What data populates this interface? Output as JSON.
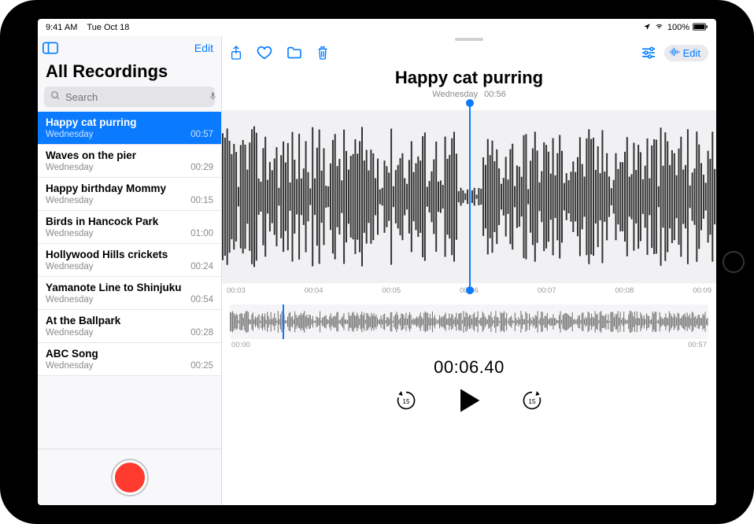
{
  "status_bar": {
    "time": "9:41 AM",
    "date": "Tue Oct 18",
    "location_icon": "location",
    "wifi_icon": "wifi",
    "battery_pct": "100%"
  },
  "sidebar": {
    "edit_label": "Edit",
    "title": "All Recordings",
    "search_placeholder": "Search",
    "items": [
      {
        "title": "Happy cat purring",
        "day": "Wednesday",
        "duration": "00:57",
        "selected": true
      },
      {
        "title": "Waves on the pier",
        "day": "Wednesday",
        "duration": "00:29",
        "selected": false
      },
      {
        "title": "Happy birthday Mommy",
        "day": "Wednesday",
        "duration": "00:15",
        "selected": false
      },
      {
        "title": "Birds in Hancock Park",
        "day": "Wednesday",
        "duration": "01:00",
        "selected": false
      },
      {
        "title": "Hollywood Hills crickets",
        "day": "Wednesday",
        "duration": "00:24",
        "selected": false
      },
      {
        "title": "Yamanote Line to Shinjuku",
        "day": "Wednesday",
        "duration": "00:54",
        "selected": false
      },
      {
        "title": "At the Ballpark",
        "day": "Wednesday",
        "duration": "00:28",
        "selected": false
      },
      {
        "title": "ABC Song",
        "day": "Wednesday",
        "duration": "00:25",
        "selected": false
      }
    ]
  },
  "detail": {
    "toolbar": {
      "share_icon": "share",
      "favorite_icon": "heart",
      "folder_icon": "folder",
      "trash_icon": "trash",
      "options_icon": "sliders",
      "edit_label": "Edit",
      "edit_icon": "waveform"
    },
    "title": "Happy cat purring",
    "day": "Wednesday",
    "length": "00:56",
    "timeline": [
      "00:03",
      "00:04",
      "00:05",
      "00:06",
      "00:07",
      "00:08",
      "00:09"
    ],
    "mini_start": "00:00",
    "mini_end": "00:57",
    "timecode": "00:06.40",
    "controls": {
      "back15": "15",
      "play": "play",
      "fwd15": "15"
    }
  }
}
